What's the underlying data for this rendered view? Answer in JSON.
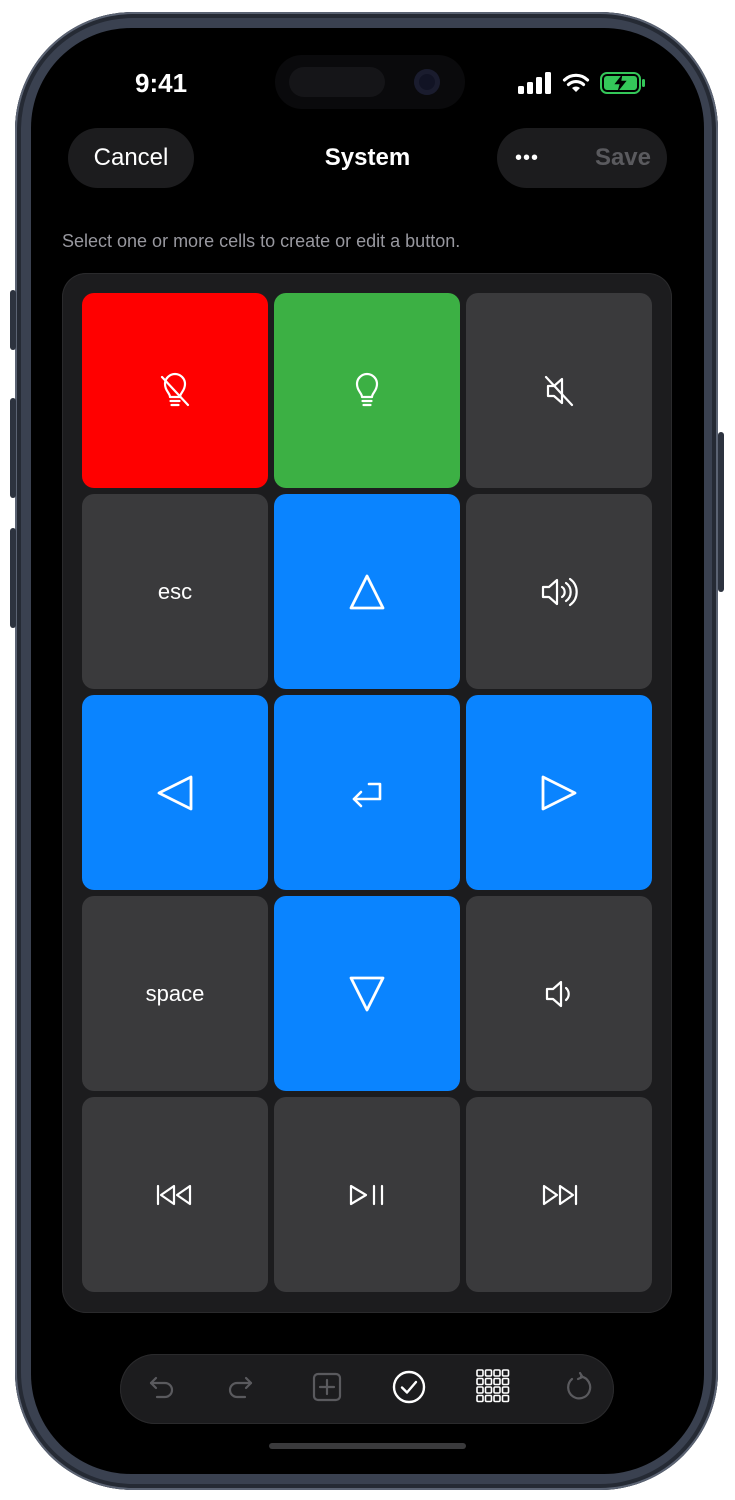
{
  "status_bar": {
    "time": "9:41"
  },
  "nav": {
    "cancel_label": "Cancel",
    "title": "System",
    "more_label": "•••",
    "save_label": "Save"
  },
  "hint": "Select one or more cells to create or edit a button.",
  "colors": {
    "red": "#ff0000",
    "green": "#3cb044",
    "blue": "#0a84ff",
    "gray": "#3a3a3c"
  },
  "grid": {
    "cells": [
      {
        "name": "light-off",
        "icon": "lightbulb-slash-icon",
        "label": "",
        "color": "red"
      },
      {
        "name": "light-on",
        "icon": "lightbulb-icon",
        "label": "",
        "color": "green"
      },
      {
        "name": "mute",
        "icon": "speaker-slash-icon",
        "label": "",
        "color": "gray"
      },
      {
        "name": "esc",
        "icon": "",
        "label": "esc",
        "color": "gray"
      },
      {
        "name": "up",
        "icon": "triangle-up-icon",
        "label": "",
        "color": "blue"
      },
      {
        "name": "volume-up",
        "icon": "speaker-wave-icon",
        "label": "",
        "color": "gray"
      },
      {
        "name": "left",
        "icon": "triangle-left-icon",
        "label": "",
        "color": "blue"
      },
      {
        "name": "return",
        "icon": "return-arrow-icon",
        "label": "",
        "color": "blue"
      },
      {
        "name": "right",
        "icon": "triangle-right-icon",
        "label": "",
        "color": "blue"
      },
      {
        "name": "space",
        "icon": "",
        "label": "space",
        "color": "gray"
      },
      {
        "name": "down",
        "icon": "triangle-down-icon",
        "label": "",
        "color": "blue"
      },
      {
        "name": "volume-down",
        "icon": "speaker-low-icon",
        "label": "",
        "color": "gray"
      },
      {
        "name": "previous",
        "icon": "backward-icon",
        "label": "",
        "color": "gray"
      },
      {
        "name": "play-pause",
        "icon": "play-pause-icon",
        "label": "",
        "color": "gray"
      },
      {
        "name": "next",
        "icon": "forward-icon",
        "label": "",
        "color": "gray"
      }
    ]
  },
  "toolbar": {
    "items": [
      {
        "name": "undo",
        "icon": "undo-icon"
      },
      {
        "name": "redo",
        "icon": "redo-icon"
      },
      {
        "name": "add",
        "icon": "plus-square-icon"
      },
      {
        "name": "select",
        "icon": "checkmark-circle-icon"
      },
      {
        "name": "grid",
        "icon": "grid-icon"
      },
      {
        "name": "reset",
        "icon": "rotate-icon"
      }
    ]
  }
}
